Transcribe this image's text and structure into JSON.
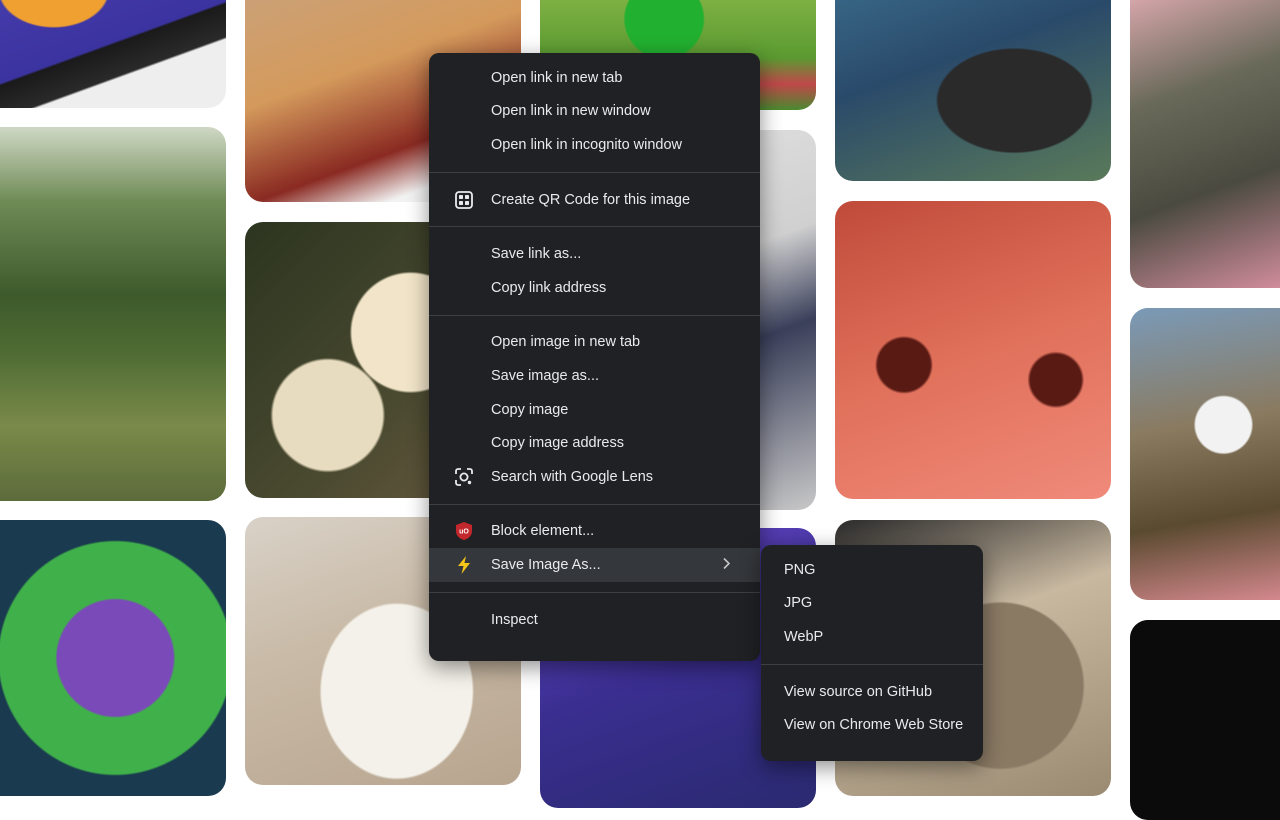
{
  "main_menu": {
    "group_links": [
      "Open link in new tab",
      "Open link in new window",
      "Open link in incognito window"
    ],
    "qr": "Create QR Code for this image",
    "group_save_link": [
      "Save link as...",
      "Copy link address"
    ],
    "group_image": [
      "Open image in new tab",
      "Save image as...",
      "Copy image",
      "Copy image address"
    ],
    "lens": "Search with Google Lens",
    "block": "Block element...",
    "save_as": "Save Image As...",
    "inspect": "Inspect"
  },
  "sub_menu": {
    "formats": [
      "PNG",
      "JPG",
      "WebP"
    ],
    "links": [
      "View source on GitHub",
      "View on Chrome Web Store"
    ]
  },
  "colors": {
    "menu_bg": "#1f2124",
    "menu_text": "#e8eaed",
    "highlight": "#34373b",
    "ublock_red": "#c1272d",
    "bolt_yellow": "#f5c518"
  }
}
